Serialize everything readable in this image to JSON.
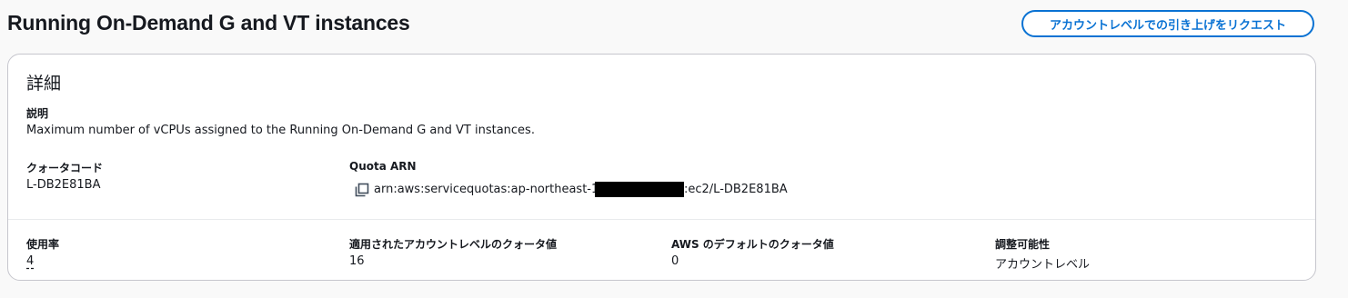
{
  "header": {
    "title": "Running On-Demand G and VT instances",
    "request_button_label": "アカウントレベルでの引き上げをリクエスト",
    "accent_color": "#0972d3"
  },
  "details": {
    "title": "詳細",
    "description_label": "説明",
    "description_value": "Maximum number of vCPUs assigned to the Running On-Demand G and VT instances.",
    "quota_code_label": "クォータコード",
    "quota_code_value": "L-DB2E81BA",
    "quota_arn_label": "Quota ARN",
    "quota_arn_prefix": "arn:aws:servicequotas:ap-northeast-1:",
    "quota_arn_suffix": ":ec2/L-DB2E81BA",
    "copy_icon": "copy-icon"
  },
  "stats": {
    "usage_label": "使用率",
    "usage_value": "4",
    "applied_label": "適用されたアカウントレベルのクォータ値",
    "applied_value": "16",
    "default_label": "AWS のデフォルトのクォータ値",
    "default_value": "0",
    "adjustable_label": "調整可能性",
    "adjustable_value": "アカウントレベル"
  }
}
